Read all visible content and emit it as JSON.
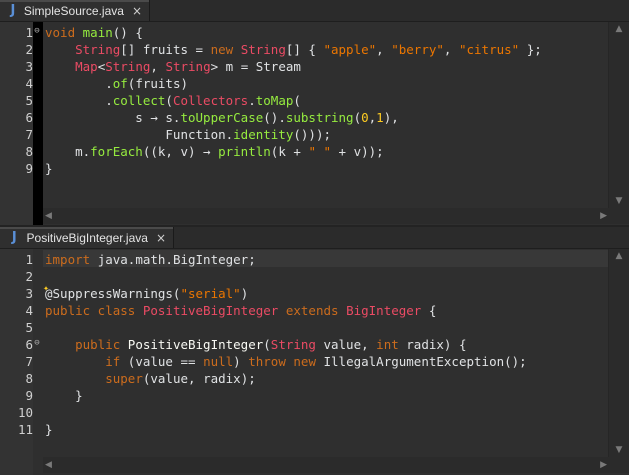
{
  "editor1": {
    "tab": {
      "icon": "java-file-icon",
      "icon_glyph": "J",
      "title": "SimpleSource.java",
      "close": "×"
    },
    "lines": [
      {
        "n": "1",
        "fold": "minus"
      },
      {
        "n": "2"
      },
      {
        "n": "3"
      },
      {
        "n": "4"
      },
      {
        "n": "5"
      },
      {
        "n": "6"
      },
      {
        "n": "7"
      },
      {
        "n": "8"
      },
      {
        "n": "9"
      }
    ],
    "code": [
      [
        [
          "kw",
          "void "
        ],
        [
          "fn",
          "main"
        ],
        [
          "pl",
          "() {"
        ]
      ],
      [
        [
          "pl",
          "    "
        ],
        [
          "ty",
          "String"
        ],
        [
          "pl",
          "[] fruits = "
        ],
        [
          "kw",
          "new "
        ],
        [
          "ty",
          "String"
        ],
        [
          "pl",
          "[] { "
        ],
        [
          "st",
          "\"apple\""
        ],
        [
          "pl",
          ", "
        ],
        [
          "st",
          "\"berry\""
        ],
        [
          "pl",
          ", "
        ],
        [
          "st",
          "\"citrus\""
        ],
        [
          "pl",
          " };"
        ]
      ],
      [
        [
          "pl",
          "    "
        ],
        [
          "ty",
          "Map"
        ],
        [
          "pl",
          "<"
        ],
        [
          "ty",
          "String"
        ],
        [
          "pl",
          ", "
        ],
        [
          "ty",
          "String"
        ],
        [
          "pl",
          "> m = Stream"
        ]
      ],
      [
        [
          "pl",
          "        ."
        ],
        [
          "fn",
          "of"
        ],
        [
          "pl",
          "(fruits)"
        ]
      ],
      [
        [
          "pl",
          "        ."
        ],
        [
          "fn",
          "collect"
        ],
        [
          "pl",
          "("
        ],
        [
          "ty",
          "Collectors"
        ],
        [
          "pl",
          "."
        ],
        [
          "fn",
          "toMap"
        ],
        [
          "pl",
          "("
        ]
      ],
      [
        [
          "pl",
          "            s → s."
        ],
        [
          "fn",
          "toUpperCase"
        ],
        [
          "pl",
          "()."
        ],
        [
          "fn",
          "substring"
        ],
        [
          "pl",
          "("
        ],
        [
          "num",
          "0"
        ],
        [
          "pl",
          ","
        ],
        [
          "num",
          "1"
        ],
        [
          "pl",
          "),"
        ]
      ],
      [
        [
          "pl",
          "                Function."
        ],
        [
          "fn",
          "identity"
        ],
        [
          "pl",
          "()));"
        ]
      ],
      [
        [
          "pl",
          "    m."
        ],
        [
          "fn",
          "forEach"
        ],
        [
          "pl",
          "((k, v) → "
        ],
        [
          "fn",
          "println"
        ],
        [
          "pl",
          "(k + "
        ],
        [
          "st",
          "\" \""
        ],
        [
          "pl",
          " + v));"
        ]
      ],
      [
        [
          "pl",
          "}"
        ]
      ]
    ]
  },
  "editor2": {
    "tab": {
      "icon": "java-file-icon",
      "icon_glyph": "J",
      "title": "PositiveBigInteger.java",
      "close": "×"
    },
    "lines": [
      {
        "n": "1"
      },
      {
        "n": "2"
      },
      {
        "n": "3"
      },
      {
        "n": "4"
      },
      {
        "n": "5"
      },
      {
        "n": "6",
        "fold": "minus"
      },
      {
        "n": "7"
      },
      {
        "n": "8"
      },
      {
        "n": "9"
      },
      {
        "n": "10"
      },
      {
        "n": "11"
      }
    ],
    "code": [
      [
        [
          "kw",
          "import "
        ],
        [
          "pl",
          "java.math.BigInteger;"
        ]
      ],
      [
        [
          "pl",
          ""
        ]
      ],
      [
        [
          "pl",
          "@SuppressWarnings("
        ],
        [
          "st",
          "\"serial\""
        ],
        [
          "pl",
          ")"
        ]
      ],
      [
        [
          "kw",
          "public class "
        ],
        [
          "ty",
          "PositiveBigInteger "
        ],
        [
          "kw",
          "extends "
        ],
        [
          "ty",
          "BigInteger "
        ],
        [
          "pl",
          "{"
        ]
      ],
      [
        [
          "pl",
          ""
        ]
      ],
      [
        [
          "pl",
          "    "
        ],
        [
          "kw",
          "public "
        ],
        [
          "cls",
          "PositiveBigInteger"
        ],
        [
          "pl",
          "("
        ],
        [
          "ty",
          "String "
        ],
        [
          "pl",
          "value, "
        ],
        [
          "kw",
          "int "
        ],
        [
          "pl",
          "radix) {"
        ]
      ],
      [
        [
          "pl",
          "        "
        ],
        [
          "kw",
          "if "
        ],
        [
          "pl",
          "(value == "
        ],
        [
          "kw",
          "null"
        ],
        [
          "pl",
          ") "
        ],
        [
          "kw",
          "throw new "
        ],
        [
          "pl",
          "IllegalArgumentException();"
        ]
      ],
      [
        [
          "pl",
          "        "
        ],
        [
          "kw",
          "super"
        ],
        [
          "pl",
          "(value, radix);"
        ]
      ],
      [
        [
          "pl",
          "    }"
        ]
      ],
      [
        [
          "pl",
          ""
        ]
      ],
      [
        [
          "pl",
          "}"
        ]
      ]
    ]
  },
  "colors": {
    "background": "#2f2f2f",
    "keyword": "#cc6c1d",
    "type": "#eb4b64",
    "string": "#ec7600",
    "method": "#96ec3f",
    "number": "#ffcd22",
    "plain": "#e0e2e4"
  },
  "scroll": {
    "up": "▲",
    "down": "▼",
    "left": "◀",
    "right": "▶"
  }
}
